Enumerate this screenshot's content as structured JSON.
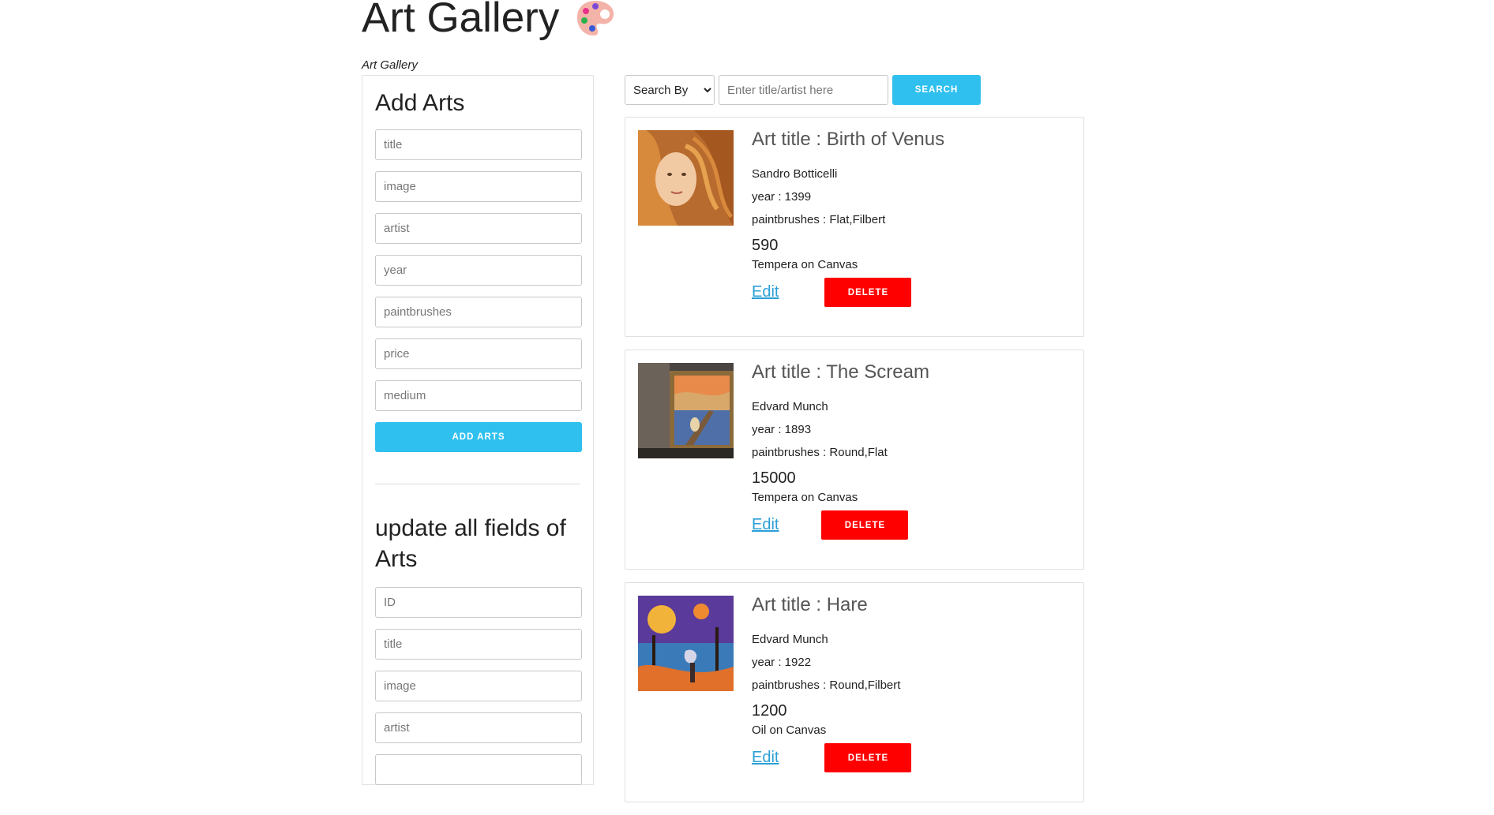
{
  "header": {
    "title": "Art Gallery",
    "subtitle": "Art Gallery",
    "icon": "artist-palette-icon"
  },
  "add_form": {
    "heading": "Add Arts",
    "placeholders": [
      "title",
      "image",
      "artist",
      "year",
      "paintbrushes",
      "price",
      "medium"
    ],
    "submit_label": "ADD ARTS"
  },
  "update_form": {
    "heading": "update all fields of Arts",
    "placeholders": [
      "ID",
      "title",
      "image",
      "artist"
    ]
  },
  "search": {
    "select_label": "Search By",
    "placeholder": "Enter title/artist here",
    "button_label": "SEARCH"
  },
  "arts": [
    {
      "title": "Art title : Birth of Venus",
      "artist": "Sandro Botticelli",
      "year": "year : 1399",
      "paintbrushes": "paintbrushes : Flat,Filbert",
      "price": "590",
      "medium": "Tempera on Canvas",
      "edit_label": "Edit",
      "delete_label": "DELETE"
    },
    {
      "title": "Art title : The Scream",
      "artist": "Edvard Munch",
      "year": "year : 1893",
      "paintbrushes": "paintbrushes : Round,Flat",
      "price": "15000",
      "medium": "Tempera on Canvas",
      "edit_label": "Edit",
      "delete_label": "DELETE"
    },
    {
      "title": "Art title : Hare",
      "artist": "Edvard Munch",
      "year": "year : 1922",
      "paintbrushes": "paintbrushes : Round,Filbert",
      "price": "1200",
      "medium": "Oil on Canvas",
      "edit_label": "Edit",
      "delete_label": "DELETE"
    }
  ],
  "colors": {
    "accent_blue": "#2fc0ef",
    "delete_red": "#ff0000",
    "link_blue": "#2a9fd6"
  }
}
